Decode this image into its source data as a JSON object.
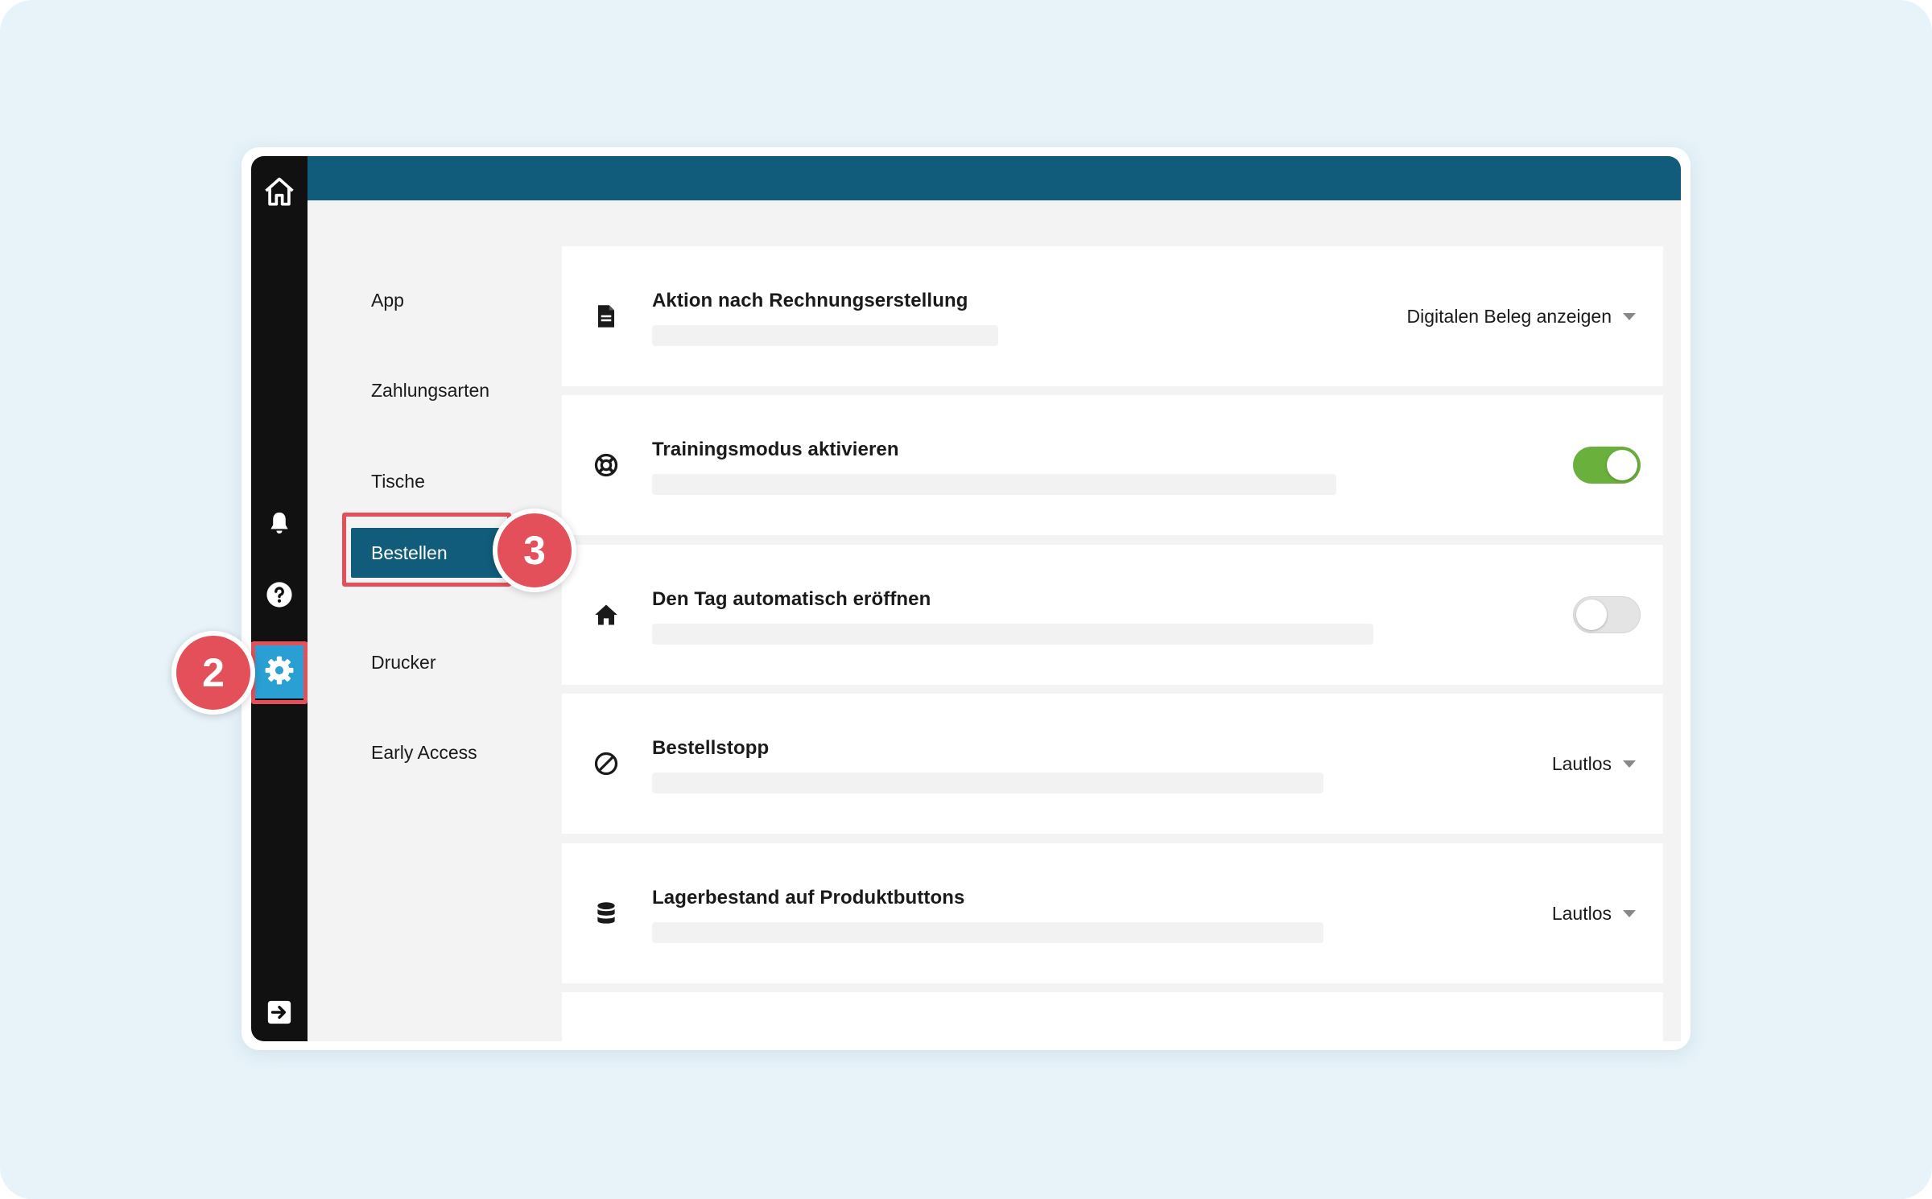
{
  "sidebar": {
    "icons": [
      "home-icon",
      "bell-icon",
      "help-icon",
      "gear-icon",
      "logout-icon"
    ],
    "active": "settings",
    "active_color": "#2a9fd3"
  },
  "header": {
    "color": "#125c7b"
  },
  "settings_nav": {
    "items": [
      {
        "label": "App"
      },
      {
        "label": "Zahlungsarten"
      },
      {
        "label": "Tische"
      },
      {
        "label": "Bestellen",
        "active": true
      },
      {
        "label": "Drucker"
      },
      {
        "label": "Early Access"
      }
    ]
  },
  "settings": [
    {
      "icon": "document-icon",
      "title": "Aktion nach Rechnungserstellung",
      "control": "dropdown",
      "value": "Digitalen Beleg anzeigen"
    },
    {
      "icon": "lifebuoy-icon",
      "title": "Trainingsmodus aktivieren",
      "control": "toggle",
      "on": true
    },
    {
      "icon": "home-icon",
      "title": "Den Tag automatisch eröffnen",
      "control": "toggle",
      "on": false
    },
    {
      "icon": "block-icon",
      "title": "Bestellstopp",
      "control": "dropdown",
      "value": "Lautlos"
    },
    {
      "icon": "database-icon",
      "title": "Lagerbestand auf Produktbuttons",
      "control": "dropdown",
      "value": "Lautlos"
    }
  ],
  "annotations": {
    "step_settings": "2",
    "step_bestellen": "3",
    "color": "#e4505a"
  },
  "colors": {
    "toggle_on": "#6ab03c",
    "background": "#e7f3f9"
  }
}
